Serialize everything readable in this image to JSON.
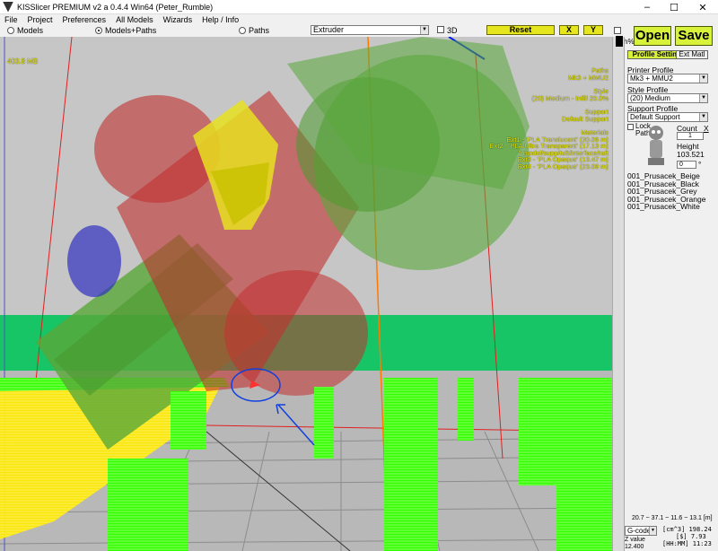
{
  "window": {
    "title": "KISSlicer PREMIUM v2 a 0.4.4 Win64 (Peter_Rumble)",
    "minimize": "–",
    "maximize": "☐",
    "close": "✕"
  },
  "menu": [
    "File",
    "Project",
    "Preferences",
    "All Models",
    "Wizards",
    "Help / Info"
  ],
  "toolbar": {
    "view_models": "Models",
    "view_models_paths": "Models+Paths",
    "view_paths": "Paths",
    "color_mode": "Extruder",
    "threed_label": "3D",
    "reset": "Reset",
    "x": "X",
    "y": "Y",
    "path_pct": "Path%",
    "open": "Open",
    "save": "Save"
  },
  "viewport": {
    "memory": "403.8 MB",
    "overlay_lines": [
      "Paths",
      "Mk3 + MMU2",
      "Style",
      "(20) Medium - Infill 20.0%",
      "Support",
      "Default Support",
      "Materials",
      "Ext1 - 'PLA Translucent' (20.06 m)",
      "Ext2 - 'PLA Ultra Transparent' (17.13 m)",
      "^ model/supp/tuft/interface/raft",
      "Ext3 - 'PLA Opaque' (13.47 m)",
      "Ext4 - 'PLA Opaque' (23.09 m)"
    ]
  },
  "panel": {
    "tab_profile": "Profile Settings",
    "tab_ext": "Ext Matl",
    "printer_label": "Printer Profile",
    "printer_value": "Mk3 + MMU2",
    "style_label": "Style Profile",
    "style_value": "(20) Medium",
    "support_label": "Support Profile",
    "support_value": "Default Support",
    "lock_label": "Lock",
    "paths_label": "Paths",
    "count_label": "Count",
    "count_value": "1",
    "x_label": "X",
    "height_label": "Height",
    "height_value": "103.521",
    "rot_value": "0",
    "deg": "°",
    "materials": [
      "001_Prusacek_Beige",
      "001_Prusacek_Black",
      "001_Prusacek_Grey",
      "001_Prusacek_Orange",
      "001_Prusacek_White"
    ]
  },
  "bottom": {
    "range": "20.7 ~ 37.1 ~ 11.6 ~ 13.1 [m]",
    "gcode": "G-code",
    "cm3_label": "[cm^3]",
    "cm3_value": "198.24",
    "dollar_label": "[$]",
    "dollar_value": "7.93",
    "time_label": "[HH:MM]",
    "time_value": "11:23",
    "zvalue_label": "Z value",
    "zvalue": "12.400"
  },
  "colors": {
    "accent_yellow": "#e6e61e",
    "open_save_green": "#d8f23c",
    "overlay_text": "#e8e800"
  }
}
